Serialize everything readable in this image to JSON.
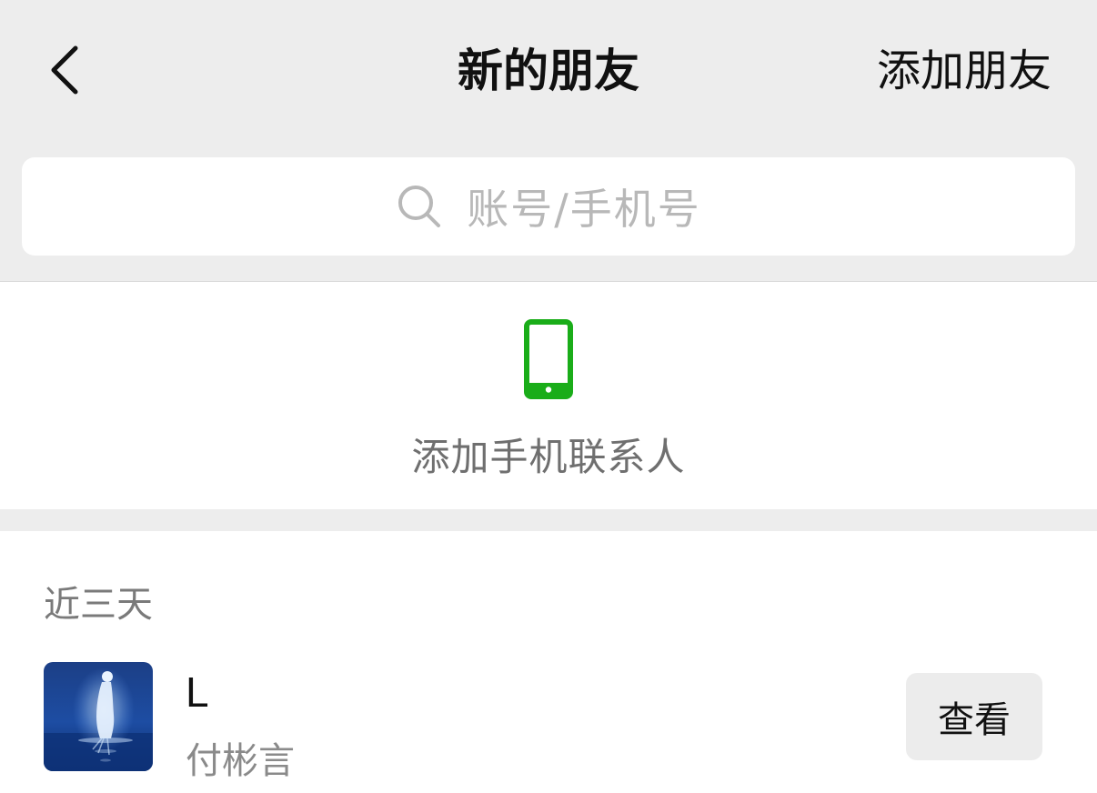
{
  "header": {
    "title": "新的朋友",
    "add_friend_label": "添加朋友",
    "back_icon": "chevron-left-icon"
  },
  "search": {
    "placeholder": "账号/手机号",
    "icon": "search-icon"
  },
  "phone_contacts": {
    "label": "添加手机联系人",
    "icon": "phone-icon",
    "icon_color": "#1aad19"
  },
  "recent": {
    "section_title": "近三天",
    "friends": [
      {
        "name": "L",
        "remark": "付彬言",
        "action_label": "查看"
      }
    ]
  },
  "colors": {
    "header_bg": "#ededed",
    "accent_green": "#1aad19",
    "placeholder_gray": "#b8b8b8"
  }
}
